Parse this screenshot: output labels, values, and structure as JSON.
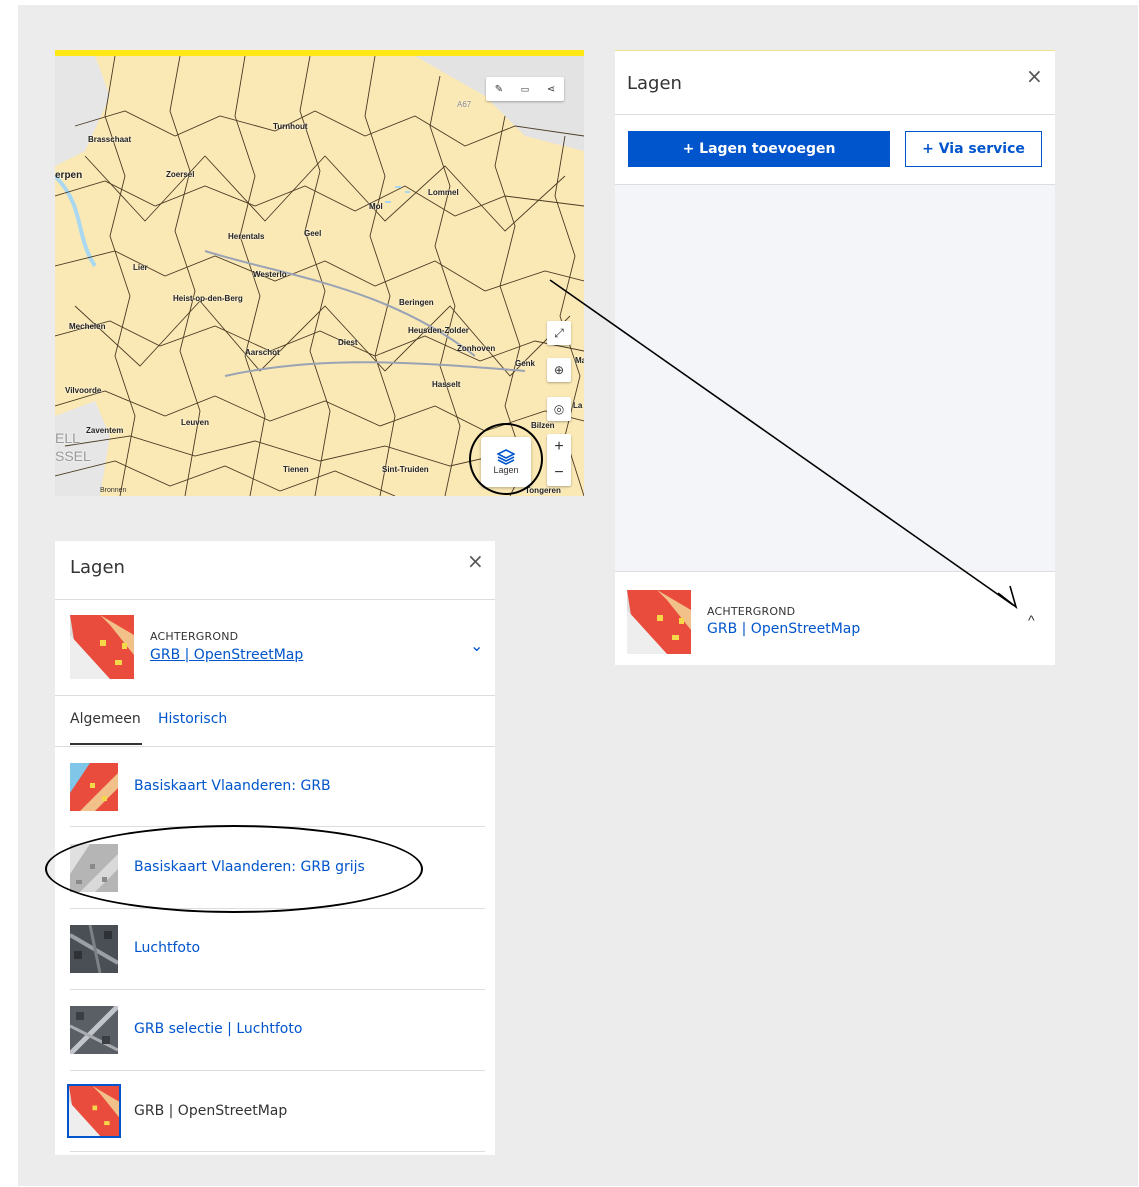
{
  "map": {
    "towns": [
      "Brasschaat",
      "Turnhout",
      "erpen",
      "Zoersel",
      "Lommel",
      "Mol",
      "Herentals",
      "Geel",
      "Lier",
      "Westerlo",
      "Heist-op-den-Berg",
      "Beringen",
      "Mechelen",
      "Heusden-Zolder",
      "Diest",
      "Zonhoven",
      "Aarschot",
      "Genk",
      "Hasselt",
      "Vilvoorde",
      "Leuven",
      "Bilzen",
      "Zaventem",
      "Tienen",
      "Sint-Truiden",
      "A67",
      "Ma",
      "La",
      "ELL",
      "SSEL",
      "Tongeren"
    ],
    "layers_button_label": "Lagen",
    "sources_label": "Bronnen",
    "toolbar_icons": [
      "pencil-icon",
      "ruler-icon",
      "share-icon"
    ],
    "side_controls": [
      "fullscreen-icon",
      "globe-icon",
      "locate-icon"
    ],
    "zoom_in": "+",
    "zoom_out": "−",
    "colors": {
      "accent_bar": "#ffe615",
      "land": "#fbe9b5",
      "borders": "#4a3b24"
    }
  },
  "panel_right": {
    "title": "Lagen",
    "close": "×",
    "add_layers_button": "+ Lagen toevoegen",
    "via_service_button": "+ Via service",
    "background_label": "ACHTERGROND",
    "background_value": "GRB | OpenStreetMap",
    "chevron": "^"
  },
  "panel_left": {
    "title": "Lagen",
    "close": "×",
    "background_label": "ACHTERGROND",
    "background_value": "GRB | OpenStreetMap",
    "chevron": "⌄",
    "tabs": [
      {
        "label": "Algemeen",
        "active": true
      },
      {
        "label": "Historisch",
        "active": false
      }
    ],
    "items": [
      {
        "label": "Basiskaart Vlaanderen: GRB",
        "thumb": "grb-color"
      },
      {
        "label": "Basiskaart Vlaanderen: GRB grijs",
        "thumb": "grb-grey"
      },
      {
        "label": "Luchtfoto",
        "thumb": "aerial"
      },
      {
        "label": "GRB selectie | Luchtfoto",
        "thumb": "aerial-grb"
      },
      {
        "label": "GRB | OpenStreetMap",
        "thumb": "grb-osm",
        "selected": true
      }
    ]
  },
  "colors": {
    "primary": "#0055cc",
    "background": "#ececec",
    "panel": "#ffffff",
    "selected_border": "#0055cc"
  }
}
